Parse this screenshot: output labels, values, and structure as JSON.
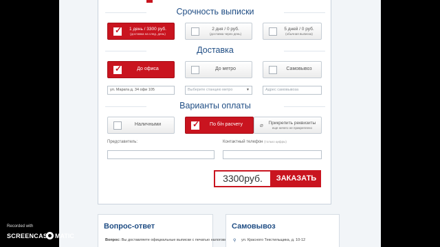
{
  "sections": {
    "urgency_title": "Срочность выписки",
    "delivery_title": "Доставка",
    "payment_title": "Варианты оплаты"
  },
  "urgency_options": [
    {
      "line1": "1 день / 3300 руб.",
      "line2": "(доставка на след. день)",
      "selected": true
    },
    {
      "line1": "2 дня / 0 руб.",
      "line2": "(доставка через день)",
      "selected": false
    },
    {
      "line1": "5 дней / 0 руб.",
      "line2": "(обычная выписка)",
      "selected": false
    }
  ],
  "delivery_options": [
    {
      "label": "До офиса",
      "selected": true
    },
    {
      "label": "До метро",
      "selected": false
    },
    {
      "label": "Самовывоз",
      "selected": false
    }
  ],
  "delivery_fields": {
    "address_value": "ул. Марата д. 34 офи 105",
    "metro_placeholder": "Выберите станцию метро",
    "pickup_placeholder": "Адрес самовывоза"
  },
  "payment_options": [
    {
      "label": "Наличными",
      "selected": false
    },
    {
      "label": "По б/н расчету",
      "selected": true
    },
    {
      "line1": "Прикрепить реквизиты",
      "line2": "еще ничего не прикреплено",
      "selected": false
    }
  ],
  "contact": {
    "representative_label": "Представитель:",
    "phone_label": "Контактный телефон",
    "phone_hint": "(только цифры)"
  },
  "order": {
    "price": "3300руб.",
    "button": "ЗАКАЗАТЬ"
  },
  "cards": {
    "faq_title": "Вопрос-ответ",
    "faq_text_bold": "Вопрос:",
    "faq_text": " Вы доставляете официальные выписки с печатью налоговой?",
    "pickup_title": "Самовывоз",
    "pickup_address": "ул. Красного Текстильщика, д. 10-12"
  },
  "watermark": {
    "recorded_with": "Recorded with",
    "brand_left": "SCREENCAST",
    "brand_right": "MATIC"
  },
  "colors": {
    "accent_red": "#c9141f",
    "title_blue": "#1f4d84",
    "page_bg": "#f2f5f8"
  }
}
